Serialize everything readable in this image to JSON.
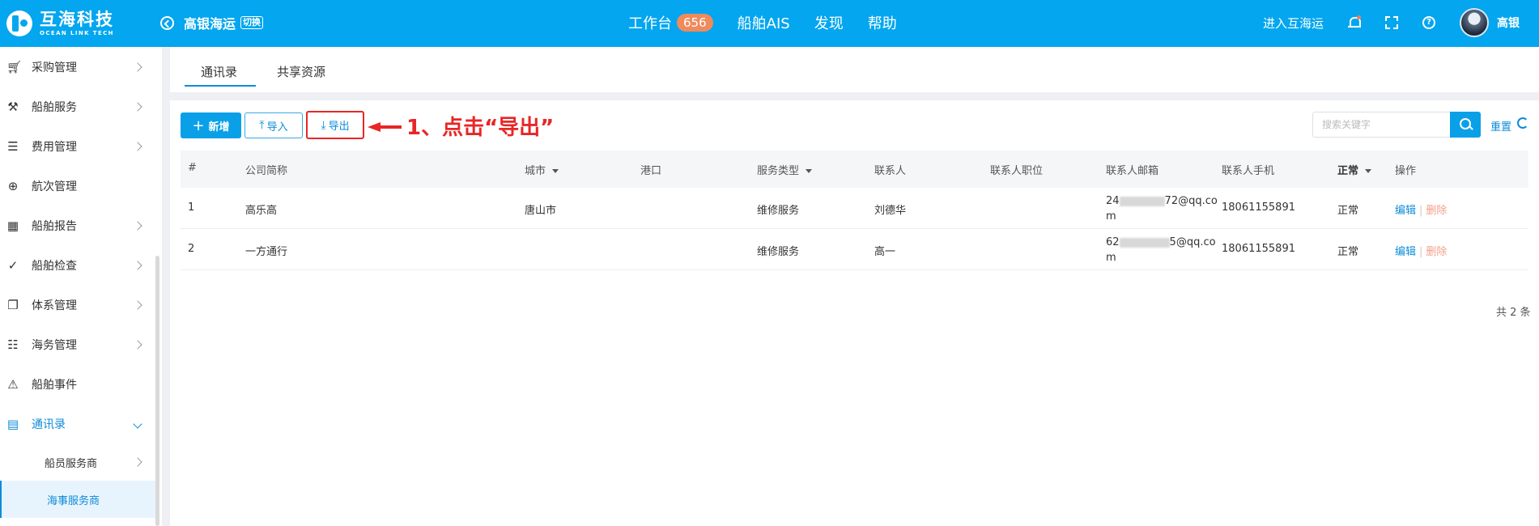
{
  "header": {
    "logo_cn": "互海科技",
    "logo_en": "OCEAN LINK TECH",
    "company": "高银海运",
    "switch_label": "切换",
    "nav": [
      {
        "label": "工作台",
        "badge": "656"
      },
      {
        "label": "船舶AIS"
      },
      {
        "label": "发现"
      },
      {
        "label": "帮助"
      }
    ],
    "enter_link": "进入互海运",
    "user_name": "高银"
  },
  "sidebar": {
    "items": [
      {
        "label": "采购管理",
        "icon": "cart-icon"
      },
      {
        "label": "船舶服务",
        "icon": "paint-roller-icon"
      },
      {
        "label": "费用管理",
        "icon": "database-icon"
      },
      {
        "label": "航次管理",
        "icon": "globe-icon"
      },
      {
        "label": "船舶报告",
        "icon": "calendar-icon"
      },
      {
        "label": "船舶检查",
        "icon": "check-circle-icon"
      },
      {
        "label": "体系管理",
        "icon": "copy-icon"
      },
      {
        "label": "海务管理",
        "icon": "signpost-icon"
      },
      {
        "label": "船舶事件",
        "icon": "warning-icon"
      },
      {
        "label": "通讯录",
        "icon": "contacts-icon"
      }
    ],
    "sub_items": [
      {
        "label": "船员服务商"
      },
      {
        "label": "海事服务商"
      }
    ]
  },
  "tabs": [
    {
      "label": "通讯录"
    },
    {
      "label": "共享资源"
    }
  ],
  "toolbar": {
    "add_label": "新增",
    "import_label": "导入",
    "export_label": "导出",
    "annotation": "1、点击“导出”",
    "search_placeholder": "搜索关键字",
    "reset_label": "重置"
  },
  "table": {
    "columns": [
      "#",
      "公司简称",
      "城市",
      "港口",
      "服务类型",
      "联系人",
      "联系人职位",
      "联系人邮箱",
      "联系人手机",
      "正常",
      "操作"
    ],
    "rows": [
      {
        "no": "1",
        "company": "高乐高",
        "city": "唐山市",
        "port": "",
        "service": "维修服务",
        "contact": "刘德华",
        "position": "",
        "email_prefix": "24",
        "email_suffix": "72@qq.co",
        "email_tail": "m",
        "phone": "18061155891",
        "status": "正常",
        "edit": "编辑",
        "delete": "删除"
      },
      {
        "no": "2",
        "company": "一方通行",
        "city": "",
        "port": "",
        "service": "维修服务",
        "contact": "高一",
        "position": "",
        "email_prefix": "62",
        "email_suffix": "5@qq.co",
        "email_tail": "m",
        "phone": "18061155891",
        "status": "正常",
        "edit": "编辑",
        "delete": "删除"
      }
    ],
    "total": "共 2 条"
  },
  "colors": {
    "topbar": "#03a6ef",
    "primary": "#0d8bd8",
    "annotation": "#e82626",
    "badge": "#f08a5d"
  }
}
